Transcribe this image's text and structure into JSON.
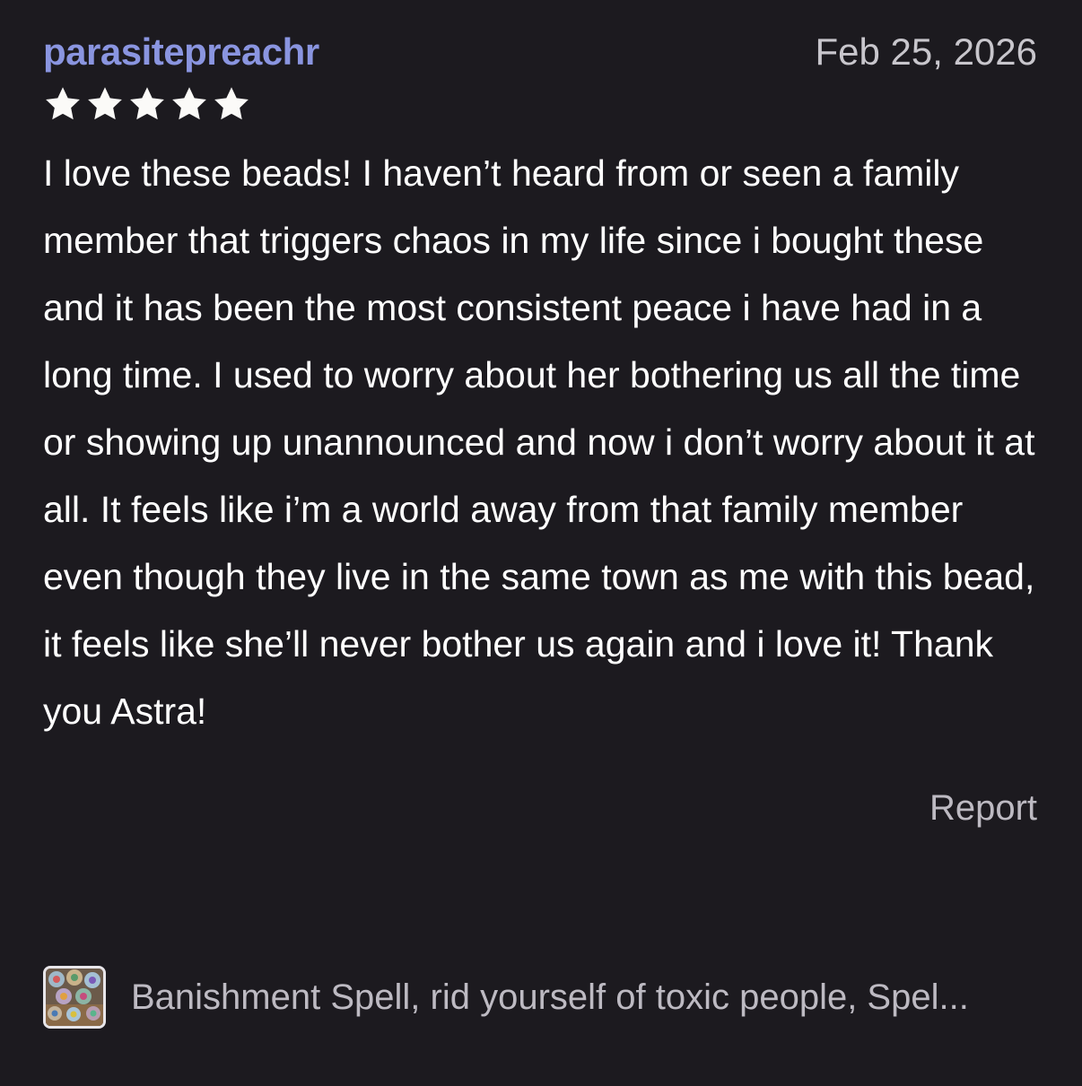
{
  "review": {
    "username": "parasitepreachr",
    "date": "Feb 25, 2026",
    "rating": 5,
    "rating_max": 5,
    "body": "I love these beads! I haven’t heard from or seen a family member that triggers chaos in my life since i bought these and it has been the most consistent peace i have had in a long time. I used to worry about her bothering us all the time or showing up unannounced and now i don’t worry about it at all. It feels like i’m a world away from that family member even though they live in the same town as me with this bead, it feels like she’ll never bother us again and i love it! Thank you Astra!",
    "report_label": "Report"
  },
  "product": {
    "title": "Banishment Spell, rid yourself of toxic people, Spel...",
    "thumbnail_icon": "beads-thumbnail"
  },
  "colors": {
    "background": "#1c1a1f",
    "username": "#8a95e0",
    "text": "#ffffff",
    "muted": "#bdbac2",
    "star": "#fbfaf8"
  }
}
